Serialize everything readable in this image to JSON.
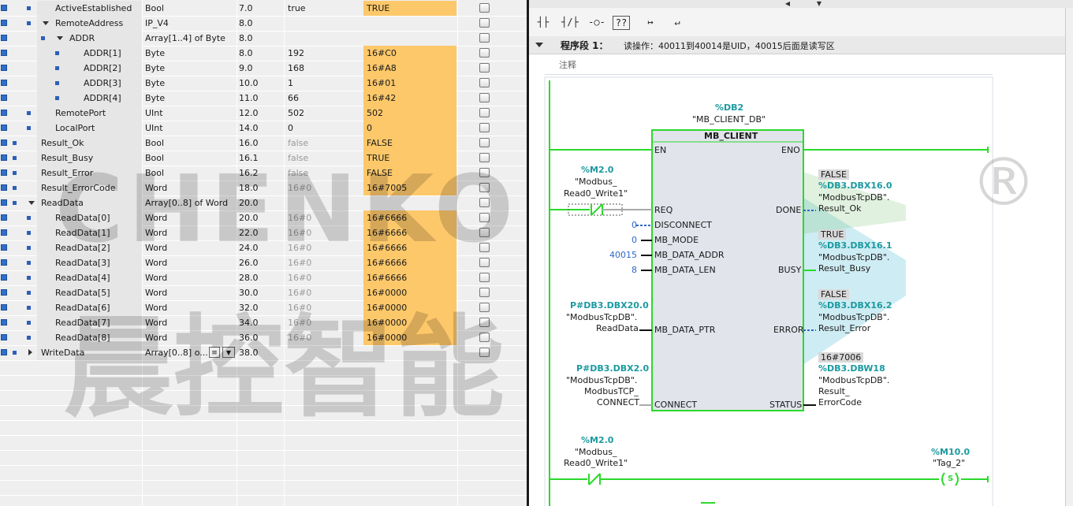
{
  "table": {
    "rows": [
      {
        "name": "ActiveEstablished",
        "indent": 1,
        "expand": "",
        "type": "Bool",
        "offset": "7.0",
        "start": "true",
        "start_gray": false,
        "monitor": "TRUE"
      },
      {
        "name": "RemoteAddress",
        "indent": 1,
        "expand": "down",
        "type": "IP_V4",
        "offset": "8.0",
        "start": "",
        "start_gray": false,
        "monitor": ""
      },
      {
        "name": "ADDR",
        "indent": 2,
        "expand": "down",
        "type": "Array[1..4] of Byte",
        "offset": "8.0",
        "start": "",
        "start_gray": false,
        "monitor": ""
      },
      {
        "name": "ADDR[1]",
        "indent": 3,
        "expand": "",
        "type": "Byte",
        "offset": "8.0",
        "start": "192",
        "start_gray": false,
        "monitor": "16#C0"
      },
      {
        "name": "ADDR[2]",
        "indent": 3,
        "expand": "",
        "type": "Byte",
        "offset": "9.0",
        "start": "168",
        "start_gray": false,
        "monitor": "16#A8"
      },
      {
        "name": "ADDR[3]",
        "indent": 3,
        "expand": "",
        "type": "Byte",
        "offset": "10.0",
        "start": "1",
        "start_gray": false,
        "monitor": "16#01"
      },
      {
        "name": "ADDR[4]",
        "indent": 3,
        "expand": "",
        "type": "Byte",
        "offset": "11.0",
        "start": "66",
        "start_gray": false,
        "monitor": "16#42"
      },
      {
        "name": "RemotePort",
        "indent": 1,
        "expand": "",
        "type": "UInt",
        "offset": "12.0",
        "start": "502",
        "start_gray": false,
        "monitor": "502"
      },
      {
        "name": "LocalPort",
        "indent": 1,
        "expand": "",
        "type": "UInt",
        "offset": "14.0",
        "start": "0",
        "start_gray": false,
        "monitor": "0"
      },
      {
        "name": "Result_Ok",
        "indent": 0,
        "expand": "",
        "type": "Bool",
        "offset": "16.0",
        "start": "false",
        "start_gray": true,
        "monitor": "FALSE"
      },
      {
        "name": "Result_Busy",
        "indent": 0,
        "expand": "",
        "type": "Bool",
        "offset": "16.1",
        "start": "false",
        "start_gray": true,
        "monitor": "TRUE"
      },
      {
        "name": "Result_Error",
        "indent": 0,
        "expand": "",
        "type": "Bool",
        "offset": "16.2",
        "start": "false",
        "start_gray": true,
        "monitor": "FALSE"
      },
      {
        "name": "Result_ErrorCode",
        "indent": 0,
        "expand": "",
        "type": "Word",
        "offset": "18.0",
        "start": "16#0",
        "start_gray": true,
        "monitor": "16#7005"
      },
      {
        "name": "ReadData",
        "indent": 0,
        "expand": "down",
        "type": "Array[0..8] of Word",
        "offset": "20.0",
        "start": "",
        "start_gray": false,
        "monitor": ""
      },
      {
        "name": "ReadData[0]",
        "indent": 1,
        "expand": "",
        "type": "Word",
        "offset": "20.0",
        "start": "16#0",
        "start_gray": true,
        "monitor": "16#6666"
      },
      {
        "name": "ReadData[1]",
        "indent": 1,
        "expand": "",
        "type": "Word",
        "offset": "22.0",
        "start": "16#0",
        "start_gray": true,
        "monitor": "16#6666"
      },
      {
        "name": "ReadData[2]",
        "indent": 1,
        "expand": "",
        "type": "Word",
        "offset": "24.0",
        "start": "16#0",
        "start_gray": true,
        "monitor": "16#6666"
      },
      {
        "name": "ReadData[3]",
        "indent": 1,
        "expand": "",
        "type": "Word",
        "offset": "26.0",
        "start": "16#0",
        "start_gray": true,
        "monitor": "16#6666"
      },
      {
        "name": "ReadData[4]",
        "indent": 1,
        "expand": "",
        "type": "Word",
        "offset": "28.0",
        "start": "16#0",
        "start_gray": true,
        "monitor": "16#6666"
      },
      {
        "name": "ReadData[5]",
        "indent": 1,
        "expand": "",
        "type": "Word",
        "offset": "30.0",
        "start": "16#0",
        "start_gray": true,
        "monitor": "16#0000"
      },
      {
        "name": "ReadData[6]",
        "indent": 1,
        "expand": "",
        "type": "Word",
        "offset": "32.0",
        "start": "16#0",
        "start_gray": true,
        "monitor": "16#0000"
      },
      {
        "name": "ReadData[7]",
        "indent": 1,
        "expand": "",
        "type": "Word",
        "offset": "34.0",
        "start": "16#0",
        "start_gray": true,
        "monitor": "16#0000"
      },
      {
        "name": "ReadData[8]",
        "indent": 1,
        "expand": "",
        "type": "Word",
        "offset": "36.0",
        "start": "16#0",
        "start_gray": true,
        "monitor": "16#0000"
      },
      {
        "name": "WriteData",
        "indent": 0,
        "expand": "right",
        "type": "Array[0..8] o...",
        "offset": "38.0",
        "start": "",
        "start_gray": false,
        "monitor": ""
      }
    ]
  },
  "watermark": {
    "latin": "CHENKONG",
    "cjk": "晨控智能",
    "reg": "®"
  },
  "ladder": {
    "segment_title": "程序段 1：",
    "segment_desc": "读操作：40011到40014是UID，40015后面是读写区",
    "comment": "注释",
    "block_instance_addr": "%DB2",
    "block_instance_name": "\"MB_CLIENT_DB\"",
    "block_type": "MB_CLIENT",
    "pin_en": "EN",
    "pin_eno": "ENO",
    "pin_req": "REQ",
    "pin_disconnect": "DISCONNECT",
    "pin_mb_mode": "MB_MODE",
    "pin_mb_data_addr": "MB_DATA_ADDR",
    "pin_mb_data_len": "MB_DATA_LEN",
    "pin_mb_data_ptr": "MB_DATA_PTR",
    "pin_connect": "CONNECT",
    "pin_done": "DONE",
    "pin_busy": "BUSY",
    "pin_error": "ERROR",
    "pin_status": "STATUS",
    "req_addr": "%M2.0",
    "req_tag1": "\"Modbus_",
    "req_tag2": "Read0_Write1\"",
    "disconnect_val": "0",
    "mb_mode_val": "0",
    "mb_data_addr_val": "40015",
    "mb_data_len_val": "8",
    "ptr_addr": "P#DB3.DBX20.0",
    "ptr_line1": "\"ModbusTcpDB\".",
    "ptr_line2": "ReadData",
    "connect_addr": "P#DB3.DBX2.0",
    "connect_line1": "\"ModbusTcpDB\".",
    "connect_line2": "ModbusTCP_",
    "connect_line3": "CONNECT",
    "done_value": "FALSE",
    "done_addr": "%DB3.DBX16.0",
    "done_line1": "\"ModbusTcpDB\".",
    "done_line2": "Result_Ok",
    "busy_value": "TRUE",
    "busy_addr": "%DB3.DBX16.1",
    "busy_line1": "\"ModbusTcpDB\".",
    "busy_line2": "Result_Busy",
    "error_value": "FALSE",
    "error_addr": "%DB3.DBX16.2",
    "error_line1": "\"ModbusTcpDB\".",
    "error_line2": "Result_Error",
    "status_value": "16#7006",
    "status_addr": "%DB3.DBW18",
    "status_line1": "\"ModbusTcpDB\".",
    "status_line2": "Result_",
    "status_line3": "ErrorCode",
    "rung2_addr": "%M2.0",
    "rung2_tag1": "\"Modbus_",
    "rung2_tag2": "Read0_Write1\"",
    "coil_addr": "%M10.0",
    "coil_tag": "\"Tag_2\"",
    "coil_symbol": "S"
  },
  "toolbar": {
    "items": [
      "┤├",
      "┤/├",
      "-○-",
      "??",
      "↦",
      "↵"
    ]
  },
  "colors": {
    "power": "#2bd92b",
    "orange": "#fdc86a",
    "teal": "#1b9aa0",
    "blue": "#2e67c8"
  }
}
